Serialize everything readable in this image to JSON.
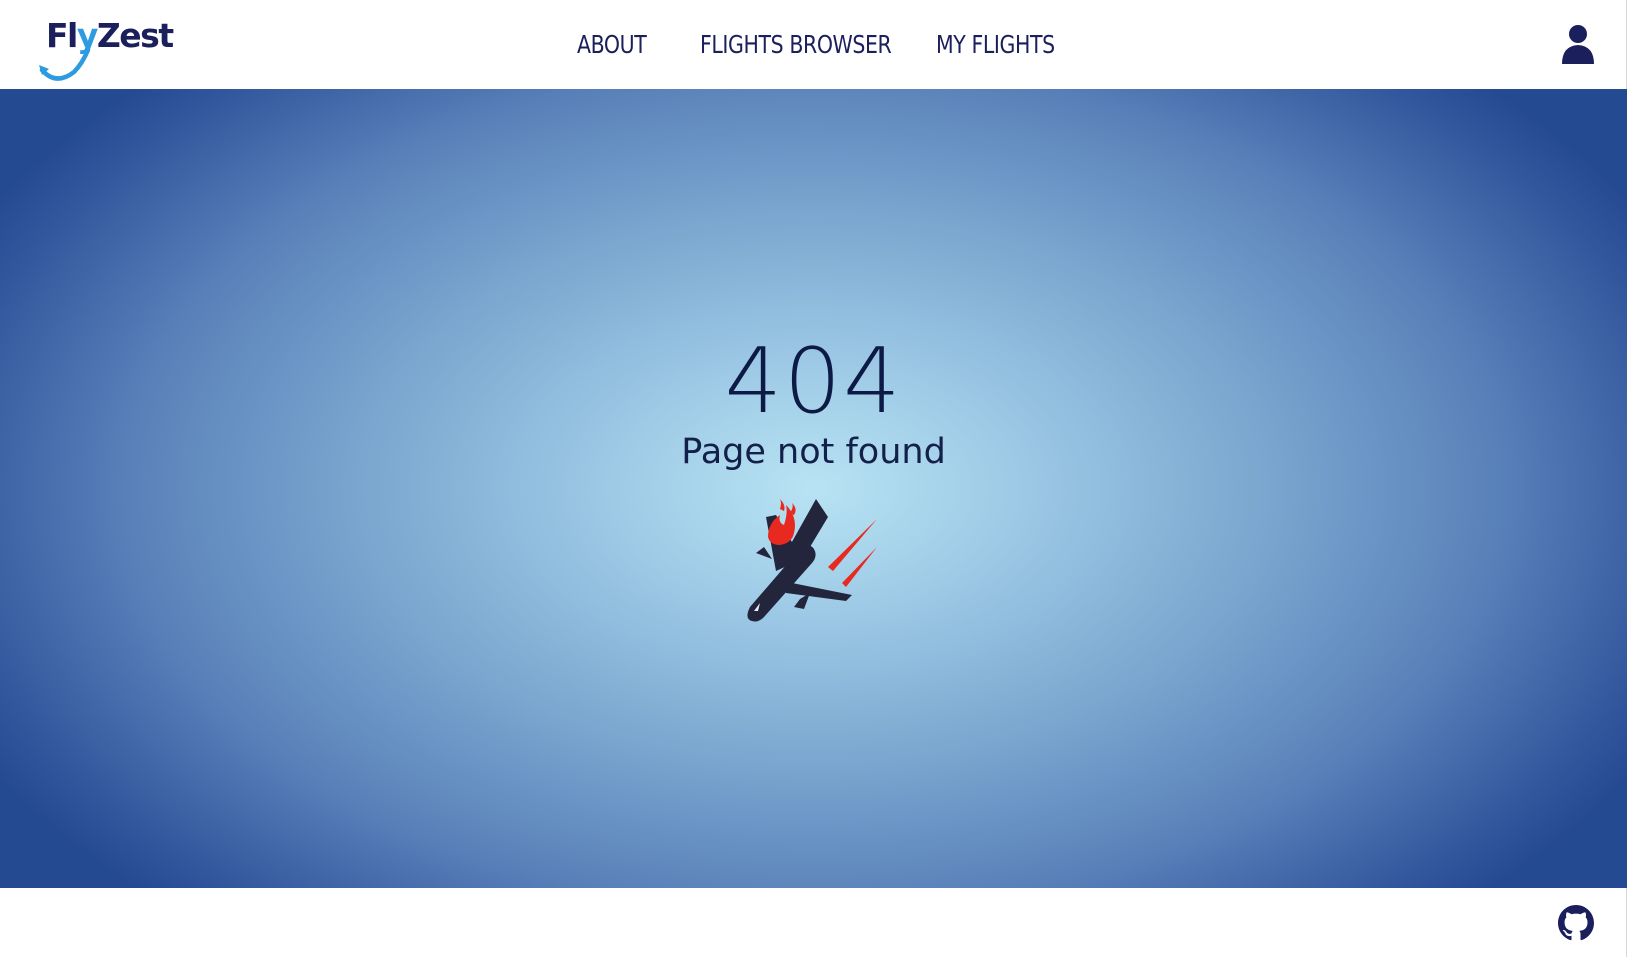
{
  "brand": {
    "name_prefix": "Fl",
    "name_accent": "y",
    "name_suffix": "Zest",
    "colors": {
      "primary": "#1b1f5c",
      "accent": "#2d9be0"
    }
  },
  "nav": {
    "items": [
      {
        "label": "ABOUT"
      },
      {
        "label": "FLIGHTS BROWSER"
      },
      {
        "label": "MY FLIGHTS"
      }
    ]
  },
  "header": {
    "user_icon": "user-icon"
  },
  "error": {
    "code": "404",
    "message": "Page not found",
    "illustration": "crashing-plane-icon",
    "flame_color": "#e8291f",
    "plane_color": "#23253d"
  },
  "footer": {
    "icon": "github-icon"
  }
}
